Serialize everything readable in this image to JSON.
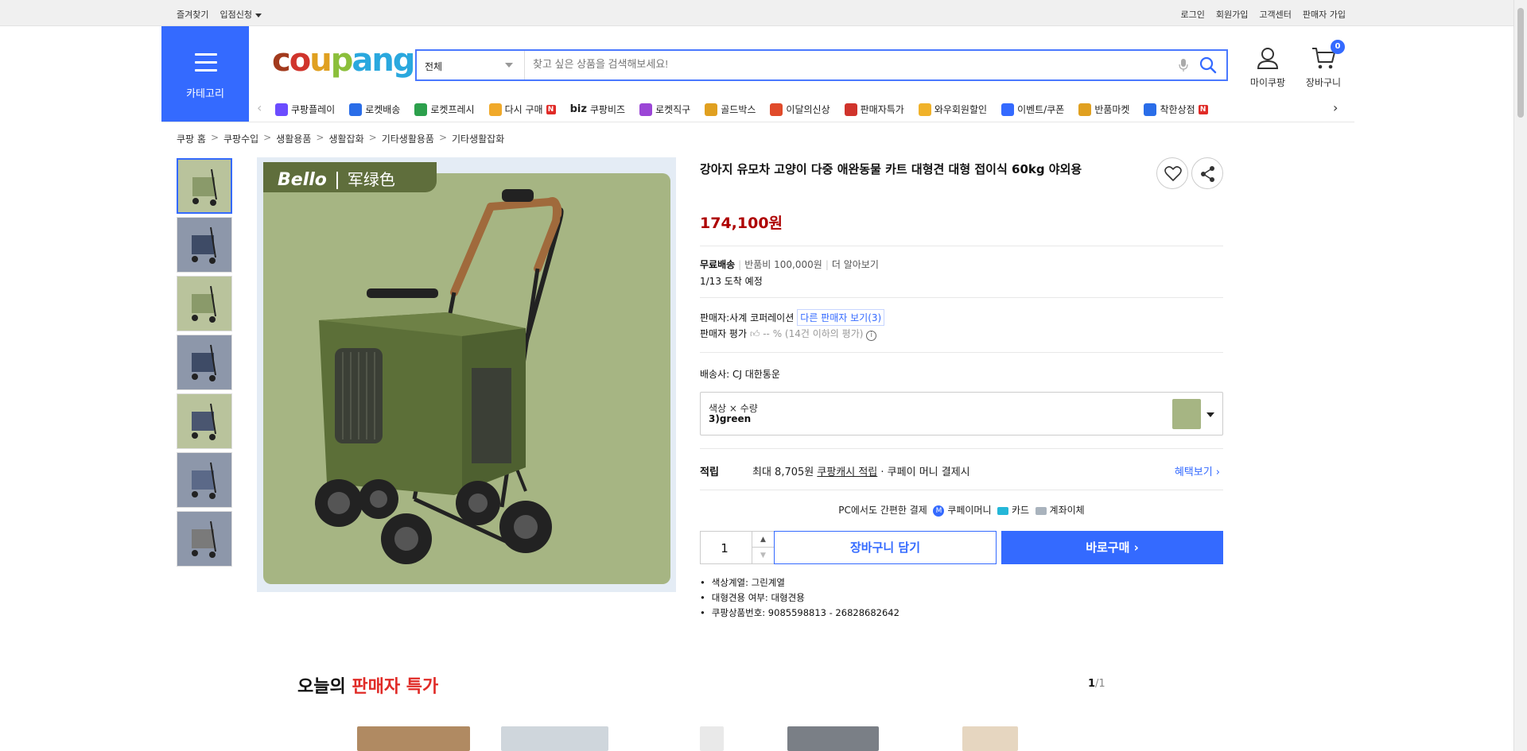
{
  "topbar": {
    "left": [
      "즐겨찾기",
      "입점신청"
    ],
    "right": [
      "로그인",
      "회원가입",
      "고객센터",
      "판매자 가입"
    ]
  },
  "header": {
    "category_label": "카테고리",
    "logo_text": [
      "c",
      "o",
      "u",
      "p",
      "ang"
    ],
    "search": {
      "category": "전체",
      "placeholder": "찾고 싶은 상품을 검색해보세요!"
    },
    "mycoupang_label": "마이쿠팡",
    "cart_label": "장바구니",
    "cart_count": "0"
  },
  "nav": {
    "items": [
      {
        "label": "쿠팡플레이",
        "icon": "play-icon",
        "color": "#6b4cff"
      },
      {
        "label": "로켓배송",
        "icon": "rocket-icon",
        "color": "#2a6de8"
      },
      {
        "label": "로켓프레시",
        "icon": "rocket-fresh-icon",
        "color": "#2ca04c"
      },
      {
        "label": "다시 구매",
        "icon": "repurchase-icon",
        "color": "#f0a92a",
        "badge": "N"
      },
      {
        "label": "쿠팡비즈",
        "icon": "biz-icon",
        "color": "#222222",
        "prefix": "biz"
      },
      {
        "label": "로켓직구",
        "icon": "global-icon",
        "color": "#9b46d6"
      },
      {
        "label": "골드박스",
        "icon": "goldbox-icon",
        "color": "#e0a020"
      },
      {
        "label": "이달의신상",
        "icon": "new-icon",
        "color": "#e04a2a"
      },
      {
        "label": "판매자특가",
        "icon": "percent-icon",
        "color": "#d0342c"
      },
      {
        "label": "와우회원할인",
        "icon": "wow-icon",
        "color": "#f0b22a"
      },
      {
        "label": "이벤트/쿠폰",
        "icon": "coupon-icon",
        "color": "#346aff"
      },
      {
        "label": "반품마켓",
        "icon": "return-market-icon",
        "color": "#e0a020"
      },
      {
        "label": "착한상점",
        "icon": "good-shop-icon",
        "color": "#2a6de8",
        "badge": "N"
      }
    ]
  },
  "breadcrumb": [
    "쿠팡 홈",
    "쿠팡수입",
    "생활용품",
    "생활잡화",
    "기타생활용품",
    "기타생활잡화"
  ],
  "gallery": {
    "tag_brand": "Bello",
    "tag_color": "军绿色",
    "thumb_colors": [
      "#8a9a6a",
      "#3e4b66",
      "#8a9a6a",
      "#3e4b66",
      "#4a5670",
      "#5b6988",
      "#7a7a7a"
    ]
  },
  "product": {
    "title": "강아지 유모차 고양이 다중 애완동물 카트 대형견 대형 접이식 60kg 야외용",
    "price": "174,100원",
    "shipping": {
      "free": "무료배송",
      "return_fee": "반품비 100,000원",
      "more": "더 알아보기",
      "arrival": "1/13 도착 예정"
    },
    "seller": {
      "label": "판매자:",
      "name": "사계 코퍼레이션",
      "other_sellers": "다른 판매자 보기(3)",
      "rating_label": "판매자 평가",
      "rating_text": "-- % (14건 이하의 평가)"
    },
    "carrier": "배송사:  CJ 대한통운",
    "option": {
      "label": "색상 × 수량",
      "value": "3)green"
    },
    "reward": {
      "label": "적립",
      "text_prefix": "최대 8,705원",
      "text_link": "쿠팡캐시 적립",
      "text_suffix": "· 쿠페이 머니 결제시",
      "more": "혜택보기"
    },
    "pay": {
      "title": "PC에서도 간편한 결제",
      "m_icon": "M",
      "money": "쿠페이머니",
      "card": "카드",
      "bank": "계좌이체"
    },
    "quantity": "1",
    "add_to_cart": "장바구니 담기",
    "buy_now": "바로구매",
    "specs": [
      "색상계열: 그린계열",
      "대형견용 여부: 대형견용",
      "쿠팡상품번호: 9085598813 - 26828682642"
    ]
  },
  "deals": {
    "title_prefix": "오늘의",
    "title_highlight": "판매자 특가",
    "page_current": "1",
    "page_total": "/1"
  }
}
